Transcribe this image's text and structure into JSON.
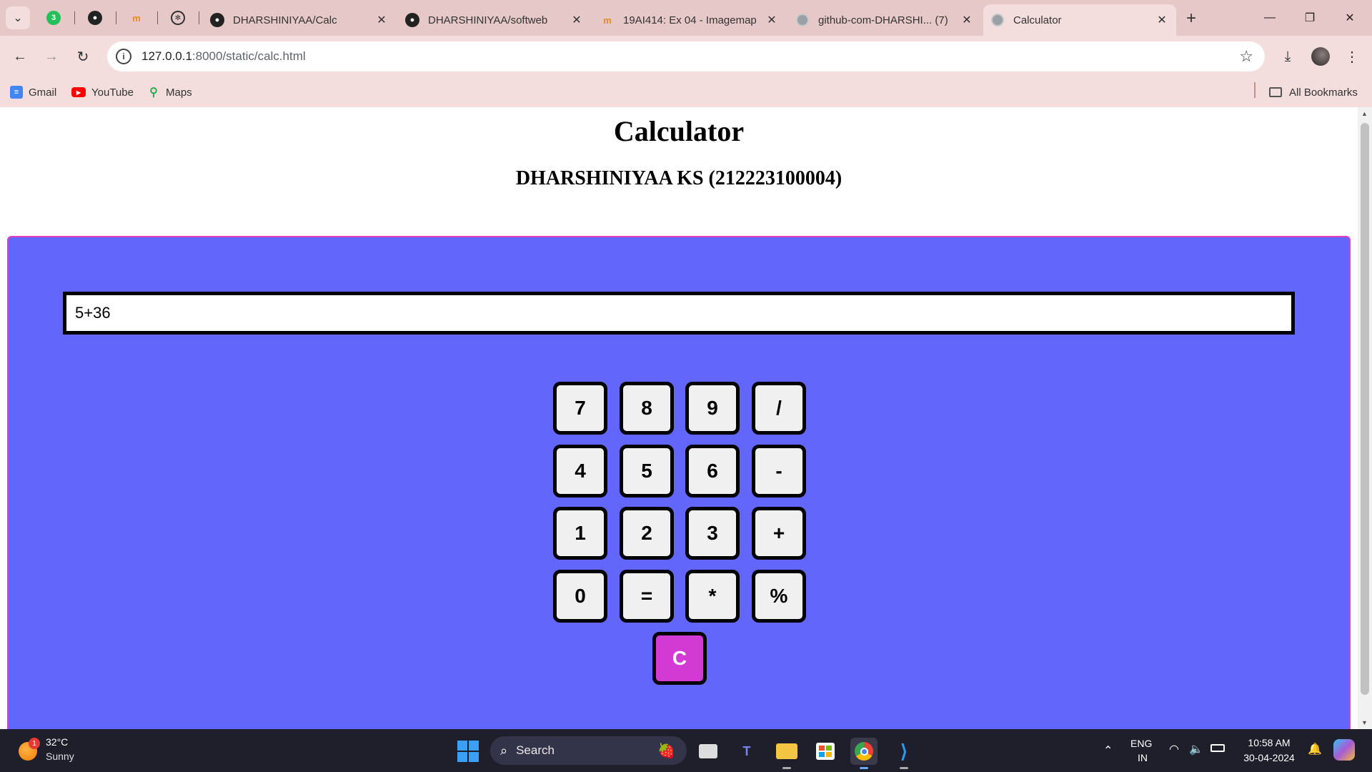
{
  "browser": {
    "tabs": [
      {
        "label": "DHARSHINIYAA/Calc",
        "icon": "github-icon"
      },
      {
        "label": "DHARSHINIYAA/softweb",
        "icon": "github-icon"
      },
      {
        "label": "19AI414: Ex 04 - Imagemap",
        "icon": "moodle-icon"
      },
      {
        "label": "github-com-DHARSHI... (7)",
        "icon": "globe-icon"
      },
      {
        "label": "Calculator",
        "icon": "globe-icon",
        "active": true
      }
    ],
    "pinned_badge": "3",
    "url_host": "127.0.0.1",
    "url_rest": ":8000/static/calc.html",
    "bookmarks": [
      "Gmail",
      "YouTube",
      "Maps"
    ],
    "all_bookmarks": "All Bookmarks"
  },
  "page": {
    "title": "Calculator",
    "subtitle": "DHARSHINIYAA KS (212223100004)",
    "display_value": "5+36",
    "keys": [
      [
        "7",
        "8",
        "9",
        "/"
      ],
      [
        "4",
        "5",
        "6",
        "-"
      ],
      [
        "1",
        "2",
        "3",
        "+"
      ],
      [
        "0",
        "=",
        "*",
        "%"
      ]
    ],
    "clear_key": "C",
    "colors": {
      "panel_bg": "#6266fb",
      "panel_border": "#e040c0",
      "key_bg": "#f0f0f0",
      "clear_bg": "#d33ad4"
    }
  },
  "taskbar": {
    "weather_badge": "1",
    "temperature": "32°C",
    "condition": "Sunny",
    "search_placeholder": "Search",
    "language": "ENG",
    "region": "IN",
    "time": "10:58 AM",
    "date": "30-04-2024"
  }
}
